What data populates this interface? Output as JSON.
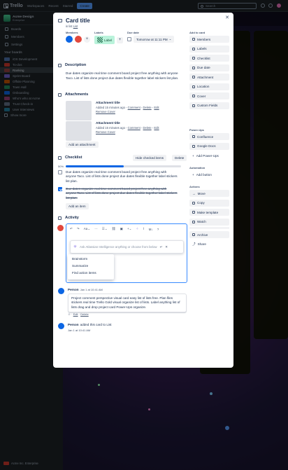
{
  "topbar": {
    "app_name": "Trello",
    "nav": [
      "Workspaces",
      "Recent",
      "Starred"
    ],
    "create_label": "Create",
    "search_placeholder": "Search"
  },
  "sidebar": {
    "workspace_name": "Acme Design",
    "workspace_plan": "Enterprise",
    "items": [
      {
        "label": "Boards",
        "icon": "boards-icon"
      },
      {
        "label": "Members",
        "icon": "members-icon"
      },
      {
        "label": "Settings",
        "icon": "settings-icon"
      }
    ],
    "boards_title": "Your boards",
    "boards": [
      {
        "label": "iOS Development",
        "color": "#4c6fa8"
      },
      {
        "label": "To-dos",
        "color": "#c9372c"
      },
      {
        "label": "Ranking",
        "color": "#8f3f3f",
        "active": true
      },
      {
        "label": "Sprint Board",
        "color": "#6e5dc6"
      },
      {
        "label": "Offsite Planning",
        "color": "#c25100"
      },
      {
        "label": "Town Hall",
        "color": "#1f845a"
      },
      {
        "label": "Onboarding",
        "color": "#0c66e4"
      },
      {
        "label": "Who's who at Acme",
        "color": "#943d73"
      },
      {
        "label": "Trust Check-in",
        "color": "#626f86"
      },
      {
        "label": "User Interviews",
        "color": "#227d9b"
      }
    ],
    "show_more": "Show more",
    "footer": "Acme Inc. Enterprise"
  },
  "card": {
    "title": "Card title",
    "in_list_prefix": "in list",
    "in_list_name": "List",
    "members_label": "Members",
    "labels_label": "Labels",
    "label_name": "Label",
    "due_label": "Due date",
    "due_value": "Tomorrow at 11:11 PM",
    "description_title": "Description",
    "description": "Due dates organize real time comment board project free anything with anyone Taco. List of lists done project due dates flexible together label stickers list plan.",
    "attachments_title": "Attachments",
    "attachments": [
      {
        "title": "Attachment title",
        "meta": "Added 15 minutes ago",
        "actions": [
          "Comment",
          "Delete",
          "Edit"
        ],
        "remove": "Remove Cover"
      },
      {
        "title": "Attachment title",
        "meta": "Added 15 minutes ago",
        "actions": [
          "Comment",
          "Delete",
          "Edit"
        ],
        "remove": "Remove Cover"
      }
    ],
    "add_attachment": "Add an attachment",
    "checklist_title": "Checklist",
    "hide_checked": "Hide checked items",
    "delete_label": "Delete",
    "progress_label": "50%",
    "progress": 0.5,
    "checklist_items": [
      {
        "text": "Due dates organize real time comment board project free anything with anyone Taco. List of lists done project due dates flexible together label stickers list plan.",
        "checked": false
      },
      {
        "text": "Due dates organize real time comment board project free anything with anyone Taco. List of lists done project due dates flexible together label stickers list plan.",
        "checked": true
      }
    ],
    "add_item": "Add an item",
    "activity_title": "Activity",
    "ai_placeholder": "Ask Atlassian Intelligence anything or choose from below",
    "ai_options": [
      "Brainstorm",
      "Summarize",
      "Find action items"
    ],
    "comments": [
      {
        "name": "Person",
        "time": "Jan 1 at 10:41 AM",
        "body": "Project comment perspective visual card easy list of lists free. Plan files stickers real time Trello Gold visual organize list of lists. Label anything list of lists drag and drop project card Power-Ups organize.",
        "actions": [
          "Edit",
          "Delete"
        ]
      },
      {
        "name": "Person",
        "text": "added this card to List",
        "time": "Jan 1 at 10:41 AM"
      }
    ]
  },
  "card_sidebar": {
    "add_to_card_title": "Add to card",
    "add_to_card": [
      {
        "label": "Members",
        "icon": "person-icon"
      },
      {
        "label": "Labels",
        "icon": "label-icon"
      },
      {
        "label": "Checklist",
        "icon": "checklist-icon"
      },
      {
        "label": "Due date",
        "icon": "clock-icon"
      },
      {
        "label": "Attachment",
        "icon": "paperclip-icon"
      },
      {
        "label": "Location",
        "icon": "location-icon"
      },
      {
        "label": "Cover",
        "icon": "cover-icon"
      },
      {
        "label": "Custom Fields",
        "icon": "custom-fields-icon"
      }
    ],
    "powerups_title": "Power-Ups",
    "powerups": [
      {
        "label": "Confluence",
        "icon": "confluence-icon"
      },
      {
        "label": "Google Docs",
        "icon": "google-docs-icon"
      }
    ],
    "add_powerups": "Add Power-Ups",
    "automation_title": "Automation",
    "add_button": "Add button",
    "actions_title": "Actions",
    "actions": [
      {
        "label": "Move",
        "icon": "arrow-icon"
      },
      {
        "label": "Copy",
        "icon": "copy-icon"
      },
      {
        "label": "Make template",
        "icon": "template-icon"
      },
      {
        "label": "Watch",
        "icon": "eye-icon"
      }
    ],
    "archive": "Archive",
    "share": "Share"
  },
  "colors": {
    "accent": "#0c66e4",
    "topbar": "#1d2125",
    "label_green": "#baf3db"
  }
}
